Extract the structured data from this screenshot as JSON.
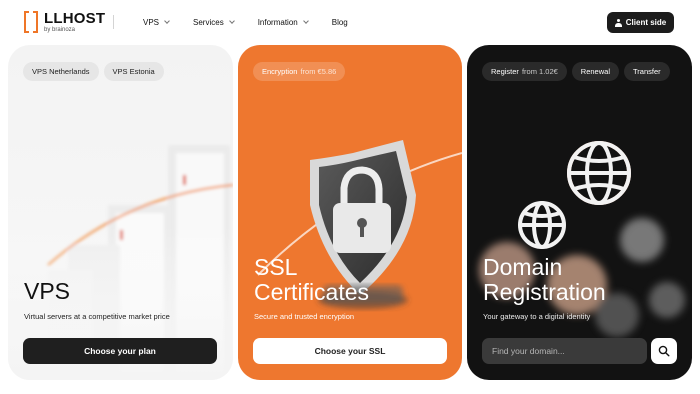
{
  "brand": {
    "name": "LLHOST",
    "tagline": "by brainoza",
    "accent": "#ef7628"
  },
  "nav": {
    "items": [
      {
        "label": "VPS",
        "has_dropdown": true
      },
      {
        "label": "Services",
        "has_dropdown": true
      },
      {
        "label": "Information",
        "has_dropdown": true
      },
      {
        "label": "Blog",
        "has_dropdown": false
      }
    ],
    "client_button": "Client side"
  },
  "cards": {
    "vps": {
      "chips": [
        "VPS Netherlands",
        "VPS Estonia"
      ],
      "title": "VPS",
      "subtitle": "Virtual servers at a competitive market price",
      "button": "Choose your plan"
    },
    "ssl": {
      "chip_label": "Encryption",
      "chip_price": "from €5.86",
      "title_line1": "SSL",
      "title_line2": "Certificates",
      "subtitle": "Secure and trusted encryption",
      "button": "Choose your SSL",
      "background": "#ee772f"
    },
    "domain": {
      "chip_register_label": "Register",
      "chip_register_price": "from 1.02€",
      "chip_renewal": "Renewal",
      "chip_transfer": "Transfer",
      "title_line1": "Domain",
      "title_line2": "Registration",
      "subtitle": "Your gateway to a digital identity",
      "search_placeholder": "Find your domain...",
      "background": "#121212"
    }
  },
  "icons": {
    "client": "user-icon",
    "search": "search-icon",
    "ssl_art": "shield-lock-icon",
    "domain_art": "globe-icon"
  }
}
